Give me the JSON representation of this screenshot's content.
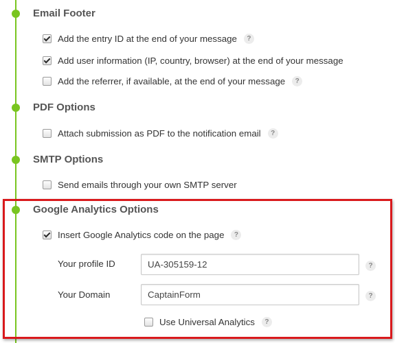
{
  "sections": {
    "email_footer": {
      "title": "Email Footer",
      "options": [
        {
          "label": "Add the entry ID at the end of your message",
          "checked": true,
          "help_icon": "?"
        },
        {
          "label": "Add user information (IP, country, browser) at the end of your message",
          "checked": true
        },
        {
          "label": "Add the referrer, if available, at the end of your message",
          "checked": false,
          "help_icon": "?"
        }
      ]
    },
    "pdf_options": {
      "title": "PDF Options",
      "options": [
        {
          "label": "Attach submission as PDF to the notification email",
          "checked": false,
          "help_icon": "?"
        }
      ]
    },
    "smtp_options": {
      "title": "SMTP Options",
      "options": [
        {
          "label": "Send emails through your own SMTP server",
          "checked": false
        }
      ]
    },
    "google_analytics": {
      "title": "Google Analytics Options",
      "insert_code": {
        "label": "Insert Google Analytics code on the page",
        "checked": true,
        "help_icon": "?"
      },
      "profile_id": {
        "label": "Your profile ID",
        "value": "UA-305159-12",
        "help_icon": "?"
      },
      "domain": {
        "label": "Your Domain",
        "value": "CaptainForm",
        "help_icon": "?"
      },
      "universal": {
        "label": "Use Universal Analytics",
        "checked": false,
        "help_icon": "?"
      }
    }
  },
  "colors": {
    "timeline": "#79c520",
    "highlight": "#d9191c",
    "title_text": "#555555"
  }
}
